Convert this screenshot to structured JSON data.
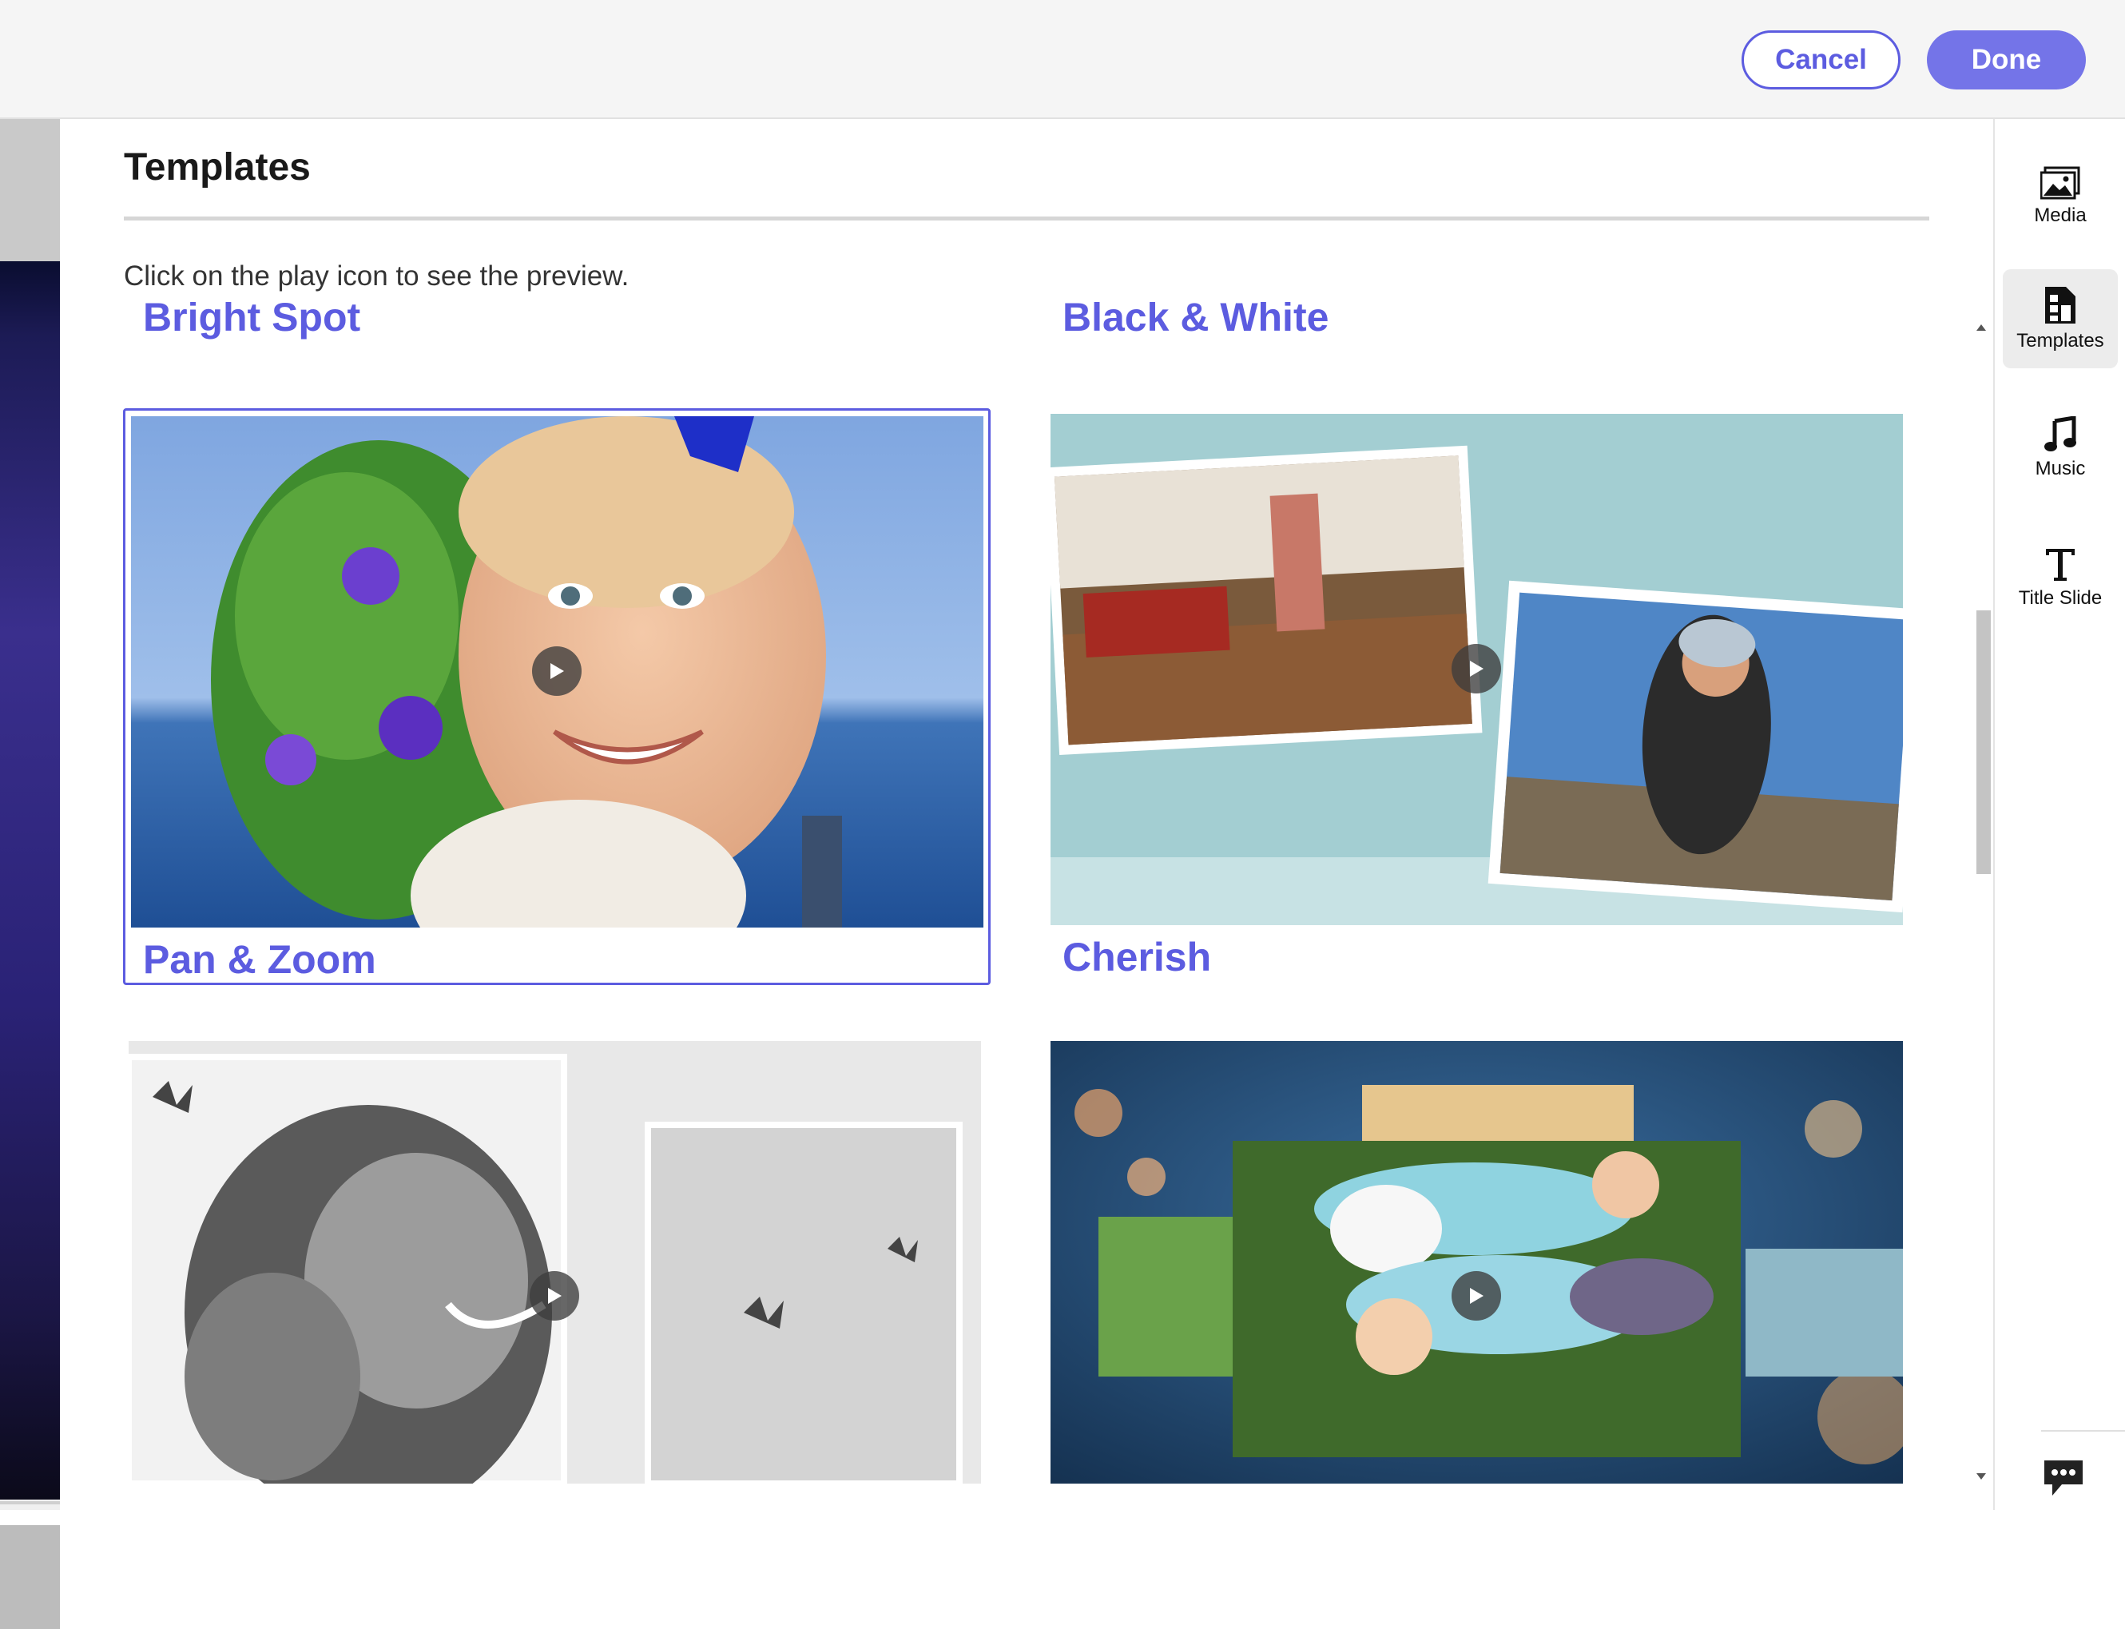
{
  "header": {
    "cancel_label": "Cancel",
    "done_label": "Done"
  },
  "panel": {
    "title": "Templates",
    "hint": "Click on the play icon to see the preview."
  },
  "templates": [
    {
      "label": "Bright Spot",
      "selected": false
    },
    {
      "label": "Black & White",
      "selected": false
    },
    {
      "label": "Pan & Zoom",
      "selected": true
    },
    {
      "label": "Cherish",
      "selected": false
    },
    {
      "label": "",
      "selected": false
    },
    {
      "label": "",
      "selected": false
    }
  ],
  "rail": {
    "items": [
      {
        "label": "Media",
        "icon": "image-icon",
        "active": false
      },
      {
        "label": "Templates",
        "icon": "templates-icon",
        "active": true
      },
      {
        "label": "Music",
        "icon": "music-note-icon",
        "active": false
      },
      {
        "label": "Title Slide",
        "icon": "text-t-icon",
        "active": false
      }
    ]
  },
  "colors": {
    "accent": "#5c5ce0",
    "done_bg": "#7474e8"
  }
}
